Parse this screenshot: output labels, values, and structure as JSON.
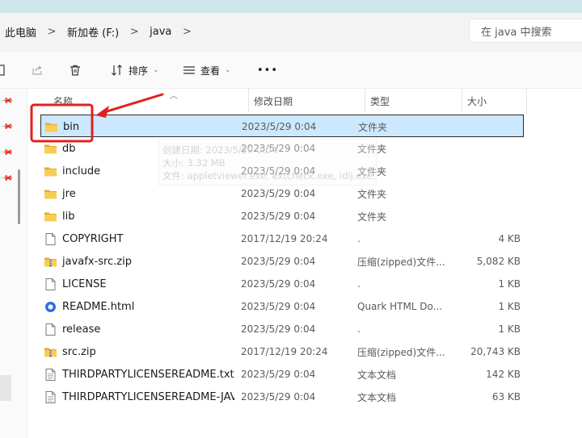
{
  "breadcrumbs": [
    "此电脑",
    "新加卷 (F:)",
    "java"
  ],
  "search": {
    "placeholder": "在 java 中搜索"
  },
  "toolbar": {
    "sort_label": "排序",
    "view_label": "查看",
    "more_label": "•••"
  },
  "columns": {
    "name": "名称",
    "date": "修改日期",
    "type": "类型",
    "size": "大小"
  },
  "files": [
    {
      "name": "bin",
      "date": "2023/5/29 0:04",
      "type": "文件夹",
      "size": "",
      "icon": "folder-icon",
      "selected": true
    },
    {
      "name": "db",
      "date": "2023/5/29 0:04",
      "type": "文件夹",
      "size": "",
      "icon": "folder-icon"
    },
    {
      "name": "include",
      "date": "2023/5/29 0:04",
      "type": "文件夹",
      "size": "",
      "icon": "folder-icon"
    },
    {
      "name": "jre",
      "date": "2023/5/29 0:04",
      "type": "文件夹",
      "size": "",
      "icon": "folder-icon"
    },
    {
      "name": "lib",
      "date": "2023/5/29 0:04",
      "type": "文件夹",
      "size": "",
      "icon": "folder-icon"
    },
    {
      "name": "COPYRIGHT",
      "date": "2017/12/19 20:24",
      "type": ".",
      "size": "4 KB",
      "icon": "file-icon"
    },
    {
      "name": "javafx-src.zip",
      "date": "2023/5/29 0:04",
      "type": "压缩(zipped)文件...",
      "size": "5,082 KB",
      "icon": "zip-folder-icon"
    },
    {
      "name": "LICENSE",
      "date": "2023/5/29 0:04",
      "type": ".",
      "size": "1 KB",
      "icon": "file-icon"
    },
    {
      "name": "README.html",
      "date": "2023/5/29 0:04",
      "type": "Quark HTML Do...",
      "size": "1 KB",
      "icon": "html-file-icon"
    },
    {
      "name": "release",
      "date": "2023/5/29 0:04",
      "type": ".",
      "size": "1 KB",
      "icon": "file-icon"
    },
    {
      "name": "src.zip",
      "date": "2017/12/19 20:24",
      "type": "压缩(zipped)文件...",
      "size": "20,743 KB",
      "icon": "zip-folder-icon"
    },
    {
      "name": "THIRDPARTYLICENSEREADME.txt",
      "date": "2023/5/29 0:04",
      "type": "文本文档",
      "size": "142 KB",
      "icon": "text-file-icon"
    },
    {
      "name": "THIRDPARTYLICENSEREADME-JAVAF...",
      "date": "2023/5/29 0:04",
      "type": "文本文档",
      "size": "63 KB",
      "icon": "text-file-icon"
    }
  ],
  "tooltip": {
    "created": "创建日期: 2023/5/29 0:04",
    "size": "大小: 3.32 MB",
    "files": "文件: appletviewer.exe, extcheck.exe, idlj.exe, ..."
  },
  "colors": {
    "selection": "#cce8ff",
    "annotation": "#e02020",
    "folder": "#f5c542"
  }
}
